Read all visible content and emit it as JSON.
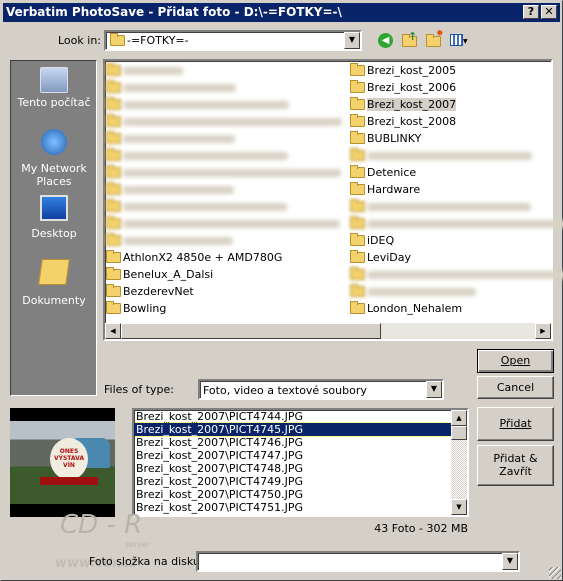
{
  "window": {
    "title": "Verbatim PhotoSave - Přidat foto - D:\\-=FOTKY=-\\",
    "help": "?",
    "close": "✕"
  },
  "toolbar": {
    "look_in_label": "Look in:",
    "look_in_value": "-=FOTKY=-",
    "icons": [
      "back-icon",
      "up-folder-icon",
      "new-folder-icon",
      "view-menu-icon"
    ]
  },
  "places": [
    {
      "label": "Tento počítač",
      "icon": "my-computer-icon"
    },
    {
      "label": "My Network Places",
      "icon": "network-places-icon"
    },
    {
      "label": "Desktop",
      "icon": "desktop-icon"
    },
    {
      "label": "Dokumenty",
      "icon": "documents-icon"
    }
  ],
  "files": {
    "col1": [
      "",
      "",
      "",
      "",
      "",
      "",
      "",
      "",
      "",
      "",
      "",
      "AthlonX2 4850e + AMD780G",
      "Benelux_A_Dalsi",
      "BezderevNet",
      "Bowling"
    ],
    "col2": [
      "Brezi_kost_2005",
      "Brezi_kost_2006",
      "Brezi_kost_2007",
      "Brezi_kost_2008",
      "BUBLINKY",
      "",
      "Detenice",
      "Hardware",
      "",
      "",
      "iDEQ",
      "LeviDay",
      "",
      "",
      "London_Nehalem"
    ],
    "highlighted": "Brezi_kost_2007"
  },
  "filetype": {
    "label": "Files of type:",
    "value": "Foto, video a textové soubory"
  },
  "buttons": {
    "open": "Open",
    "cancel": "Cancel",
    "add": "Přidat",
    "add_close": "Přidat & Zavřít"
  },
  "selection_list": {
    "items": [
      "Brezi_kost_2007\\PICT4744.JPG",
      "Brezi_kost_2007\\PICT4745.JPG",
      "Brezi_kost_2007\\PICT4746.JPG",
      "Brezi_kost_2007\\PICT4747.JPG",
      "Brezi_kost_2007\\PICT4748.JPG",
      "Brezi_kost_2007\\PICT4749.JPG",
      "Brezi_kost_2007\\PICT4750.JPG",
      "Brezi_kost_2007\\PICT4751.JPG"
    ],
    "selected_index": 1
  },
  "status": "43 Foto - 302 MB",
  "disk_folder": {
    "label": "Foto složka na disku:",
    "value": ""
  },
  "watermark": {
    "text": "CD - R",
    "sub": "server",
    "url": "www.cdr.cz"
  },
  "colors": {
    "titlebar": "#0a246a",
    "selection": "#0a246a",
    "places_bg": "#808080"
  }
}
